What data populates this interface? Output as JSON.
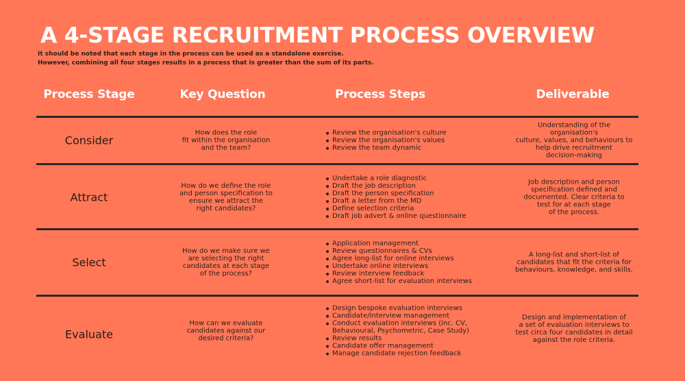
{
  "title": "A 4-STAGE RECRUITMENT PROCESS OVERVIEW",
  "subtitle": [
    "It should be noted that each stage in the process can be used as a standalone exercise.",
    "However, combining all four stages results in a process that is greater than the sum of its parts."
  ],
  "headers": {
    "stage": "Process Stage",
    "question": "Key Question",
    "steps": "Process Steps",
    "deliverable": "Deliverable"
  },
  "colors": {
    "background": "#FF7757",
    "heading_text": "#FFFFFF",
    "body_text": "#2A1E1A",
    "rule": "#2E2624"
  },
  "rows": [
    {
      "stage": "Consider",
      "question": "How does the role\nfit within the organisation\nand the team?",
      "steps": [
        "Review the organisation's culture",
        "Review the organisation's values",
        "Review the team dynamic"
      ],
      "deliverable": "Understanding of the\norganisation's\nculture, values, and behaviours to\nhelp drive recruitment\ndecision-making"
    },
    {
      "stage": "Attract",
      "question": "How do we define the role\nand person specification to\nensure  we attract the\nright candidates?",
      "steps": [
        "Undertake a role diagnostic",
        "Draft the job description",
        "Draft the person specification",
        "Draft a letter from the MD",
        "Define selection criteria",
        "Draft job advert & online questionnaire"
      ],
      "deliverable": "Job description and person\nspecification defined and\ndocumented.  Clear criteria to\ntest for at each stage\nof the process."
    },
    {
      "stage": "Select",
      "question": "How do we make sure we\nare selecting the right\ncandidates at each stage\nof the process?",
      "steps": [
        "Application management",
        "Review questionnaires & CVs",
        "Agree long-list for online interviews",
        "Undertake online interviews",
        "Review interview feedback",
        "Agree short-list for evaluation interviews"
      ],
      "deliverable": "A long-list and short-list of\ncandidates that fit the criteria for\nbehaviours, knowledge, and skills."
    },
    {
      "stage": "Evaluate",
      "question": "How can we evaluate\ncandidates against our\ndesired criteria?",
      "steps": [
        "Design bespoke evaluation interviews",
        "Candidate/Interview management",
        "Conduct evaluation interviews (inc. CV,\nBehavioural, Psychometric, Case Study)",
        "Review results",
        "Candidate offer management",
        "Manage candidate rejection feedback"
      ],
      "deliverable": "Design and implementation of\na set of evaluation interviews to\ntest circa four candidates in detail\nagainst the role criteria."
    }
  ]
}
